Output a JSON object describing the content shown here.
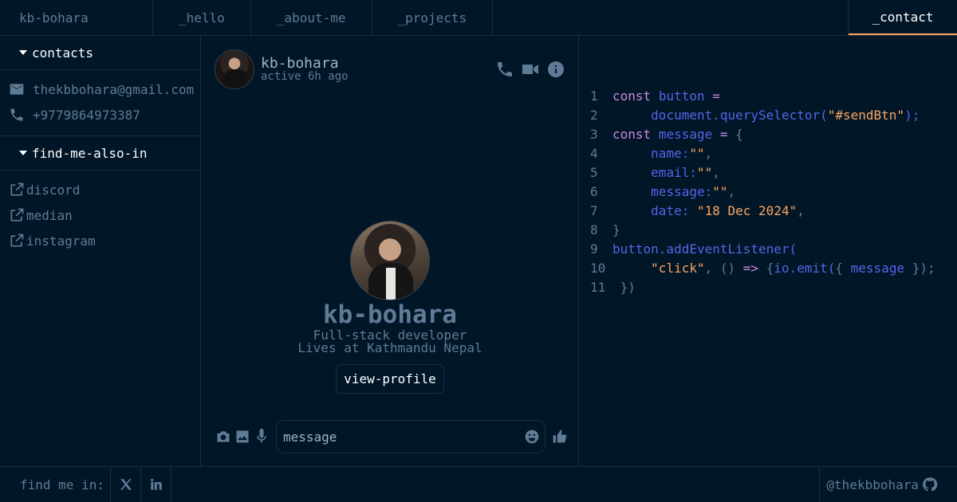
{
  "header": {
    "brand": "kb-bohara",
    "tabs": [
      {
        "label": "_hello"
      },
      {
        "label": "_about-me"
      },
      {
        "label": "_projects"
      }
    ],
    "active_tab": "_contact"
  },
  "sidebar": {
    "contacts_title": "contacts",
    "contacts": [
      {
        "icon": "mail-icon",
        "value": "thekbbohara@gmail.com"
      },
      {
        "icon": "phone-icon",
        "value": "+9779864973387"
      }
    ],
    "find_title": "find-me-also-in",
    "links": [
      {
        "icon": "external-link-icon",
        "label": "discord"
      },
      {
        "icon": "external-link-icon",
        "label": "median"
      },
      {
        "icon": "external-link-icon",
        "label": "instagram"
      }
    ]
  },
  "chat": {
    "name": "kb-bohara",
    "status": "active 6h ago",
    "profile": {
      "name": "kb-bohara",
      "role": "Full-stack developer",
      "location": "Lives at Kathmandu Nepal",
      "button": "view-profile"
    },
    "composer": {
      "placeholder": "message"
    }
  },
  "code": {
    "lines": [
      "1",
      "2",
      "3",
      "4",
      "5",
      "6",
      "7",
      "8",
      "9",
      "10",
      "11"
    ],
    "const1": "const",
    "button_var": "button",
    "doc": "document.querySelector(",
    "sel": "\"#sendBtn\"",
    "const2": "const",
    "message_var": "message",
    "name_key": "name:",
    "email_key": "email:",
    "message_key": "message:",
    "date_key": "date:",
    "empty_str": "\"\"",
    "date_val": "\"18 Dec 2024\"",
    "listener": "button.addEventListener(",
    "click": "\"click\"",
    "emit": "io.emit(",
    "emit_arg": "message"
  },
  "footer": {
    "find_label": "find me in:",
    "socials": [
      "x-icon",
      "linkedin-icon"
    ],
    "github_handle": "@thekbbohara"
  },
  "colors": {
    "background": "#011627",
    "border": "#1e2d3d",
    "text": "#607b96",
    "accent": "#fea55f",
    "keyword": "#c98bdf",
    "identifier": "#5565e8"
  }
}
